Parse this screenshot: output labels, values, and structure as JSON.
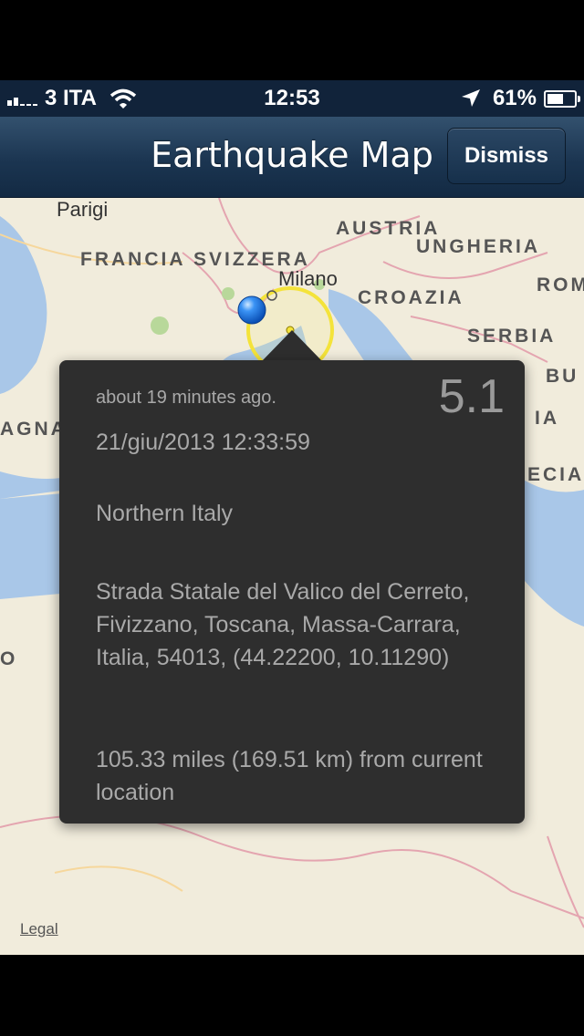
{
  "status_bar": {
    "carrier": "3 ITA",
    "time": "12:53",
    "battery": "61%",
    "battery_level": 0.61
  },
  "nav": {
    "title": "Earthquake Map",
    "dismiss_label": "Dismiss"
  },
  "map": {
    "labels": {
      "parigi": "Parigi",
      "francia": "FRANCIA",
      "svizzera": "SVIZZERA",
      "austria": "AUSTRIA",
      "ungheria": "UNGHERIA",
      "milano": "Milano",
      "croazia": "CROAZIA",
      "rom": "ROM",
      "serbia": "SERBIA",
      "bu": "BU",
      "ia": "IA",
      "agna": "AGNA",
      "ecia": "ECIA",
      "o": "O"
    },
    "legal": "Legal",
    "icons": [
      "location-pin-icon",
      "epicenter-circle-icon",
      "location-arrow-icon",
      "wifi-icon",
      "battery-icon"
    ]
  },
  "popover": {
    "magnitude": "5.1",
    "time_ago": "about 19 minutes ago.",
    "datetime": "21/giu/2013 12:33:59",
    "region": "Northern Italy",
    "address": "Strada Statale del Valico del Cerreto, Fivizzano, Toscana, Massa-Carrara, Italia, 54013, (44.22200, 10.11290)",
    "distance": "105.33 miles (169.51 km) from current location"
  }
}
